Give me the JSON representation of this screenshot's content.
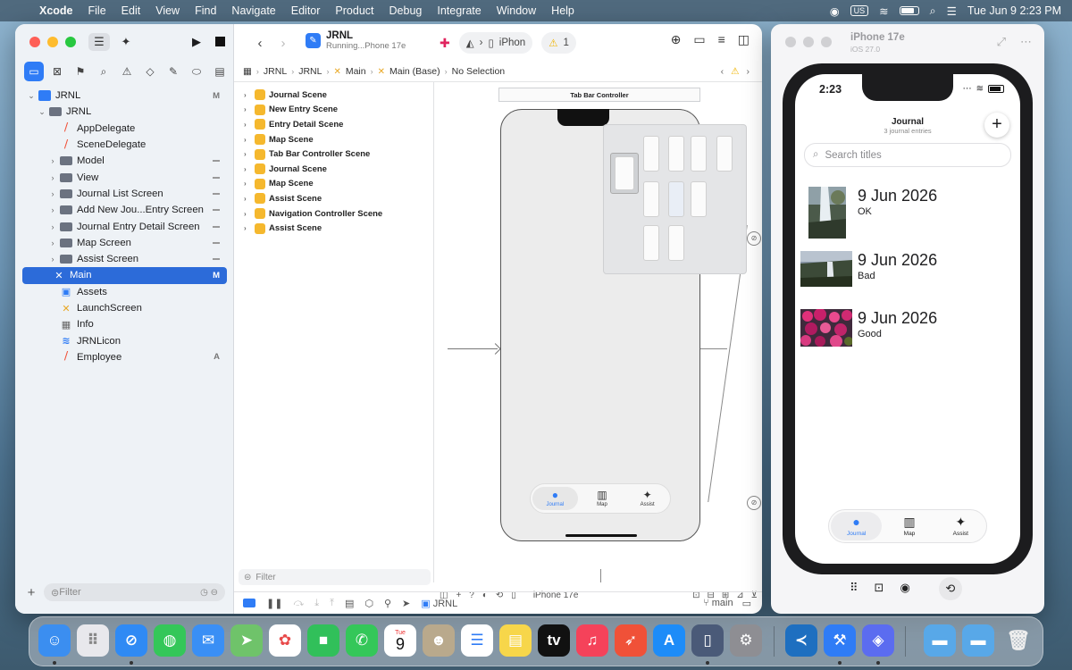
{
  "menubar": {
    "app": "Xcode",
    "items": [
      "File",
      "Edit",
      "View",
      "Find",
      "Navigate",
      "Editor",
      "Product",
      "Debug",
      "Integrate",
      "Window",
      "Help"
    ],
    "input_source": "US",
    "datetime": "Tue Jun 9  2:23 PM"
  },
  "xcode": {
    "scheme": {
      "project": "JRNL",
      "status": "Running...Phone 17e"
    },
    "destination": "iPhon",
    "warning_count": "1",
    "jumpbar": [
      "JRNL",
      "JRNL",
      "Main",
      "Main (Base)",
      "No Selection"
    ],
    "navigator": [
      {
        "label": "JRNL",
        "level": 0,
        "kind": "project",
        "badge": "M",
        "expanded": true
      },
      {
        "label": "JRNL",
        "level": 1,
        "kind": "folder",
        "badge": "",
        "expanded": true
      },
      {
        "label": "AppDelegate",
        "level": 2,
        "kind": "swift",
        "badge": ""
      },
      {
        "label": "SceneDelegate",
        "level": 2,
        "kind": "swift",
        "badge": ""
      },
      {
        "label": "Model",
        "level": 2,
        "kind": "folder",
        "badge": "-",
        "collapsed": true
      },
      {
        "label": "View",
        "level": 2,
        "kind": "folder",
        "badge": "-",
        "collapsed": true
      },
      {
        "label": "Journal List Screen",
        "level": 2,
        "kind": "folder",
        "badge": "-",
        "collapsed": true
      },
      {
        "label": "Add New Jou...Entry Screen",
        "level": 2,
        "kind": "folder",
        "badge": "-",
        "collapsed": true
      },
      {
        "label": "Journal Entry Detail Screen",
        "level": 2,
        "kind": "folder",
        "badge": "-",
        "collapsed": true
      },
      {
        "label": "Map Screen",
        "level": 2,
        "kind": "folder",
        "badge": "-",
        "collapsed": true
      },
      {
        "label": "Assist Screen",
        "level": 2,
        "kind": "folder",
        "badge": "-",
        "collapsed": true
      },
      {
        "label": "Main",
        "level": 2,
        "kind": "storyboard",
        "badge": "M",
        "selected": true
      },
      {
        "label": "Assets",
        "level": 2,
        "kind": "assets",
        "badge": ""
      },
      {
        "label": "LaunchScreen",
        "level": 2,
        "kind": "storyboard",
        "badge": ""
      },
      {
        "label": "Info",
        "level": 2,
        "kind": "plist",
        "badge": ""
      },
      {
        "label": "JRNLicon",
        "level": 2,
        "kind": "icon",
        "badge": ""
      },
      {
        "label": "Employee",
        "level": 2,
        "kind": "swift",
        "badge": "A"
      }
    ],
    "navigator_filter_placeholder": "Filter",
    "outline": [
      "Journal Scene",
      "New Entry Scene",
      "Entry Detail Scene",
      "Map Scene",
      "Tab Bar Controller Scene",
      "Journal Scene",
      "Map Scene",
      "Assist Scene",
      "Navigation Controller Scene",
      "Assist Scene"
    ],
    "outline_filter_placeholder": "Filter",
    "canvas": {
      "controller_title": "Tab Bar Controller",
      "tabs": [
        {
          "icon": "person-icon",
          "label": "Journal",
          "selected": true
        },
        {
          "icon": "map-icon",
          "label": "Map"
        },
        {
          "icon": "sparkle-icon",
          "label": "Assist"
        }
      ],
      "device": "iPhone 17e"
    },
    "debug_bar": {
      "target": "JRNL",
      "branch": "main"
    }
  },
  "simulator": {
    "title": "iPhone 17e",
    "os": "iOS 27.0",
    "time": "2:23",
    "nav_title": "Journal",
    "nav_subtitle": "3 journal entries",
    "search_placeholder": "Search titles",
    "entries": [
      {
        "date": "9 Jun 2026",
        "mood": "OK",
        "photo": "waterfall"
      },
      {
        "date": "9 Jun 2026",
        "mood": "Bad",
        "photo": "cliff-waterfall"
      },
      {
        "date": "9 Jun 2026",
        "mood": "Good",
        "photo": "flowers"
      }
    ],
    "tabs": [
      {
        "icon": "person-icon",
        "label": "Journal",
        "selected": true
      },
      {
        "icon": "map-icon",
        "label": "Map"
      },
      {
        "icon": "sparkle-icon",
        "label": "Assist"
      }
    ]
  },
  "dock": [
    "Finder",
    "Launchpad",
    "Safari",
    "Messages",
    "Mail",
    "Maps",
    "Photos",
    "FaceTime",
    "Phone",
    "Calendar",
    "Contacts",
    "Reminders",
    "Notes",
    "TV",
    "Music",
    "Rocket",
    "App Store",
    "Simulator",
    "System Settings",
    "VS Code",
    "Xcode Beta",
    "Copilot",
    "Folder",
    "Folder",
    "Trash"
  ],
  "dock_calendar": {
    "weekday": "Tue",
    "day": "9"
  },
  "colors": {
    "accent": "#2f7cf6",
    "selection": "#2c6bd9",
    "scene_icon": "#f5b82e"
  }
}
